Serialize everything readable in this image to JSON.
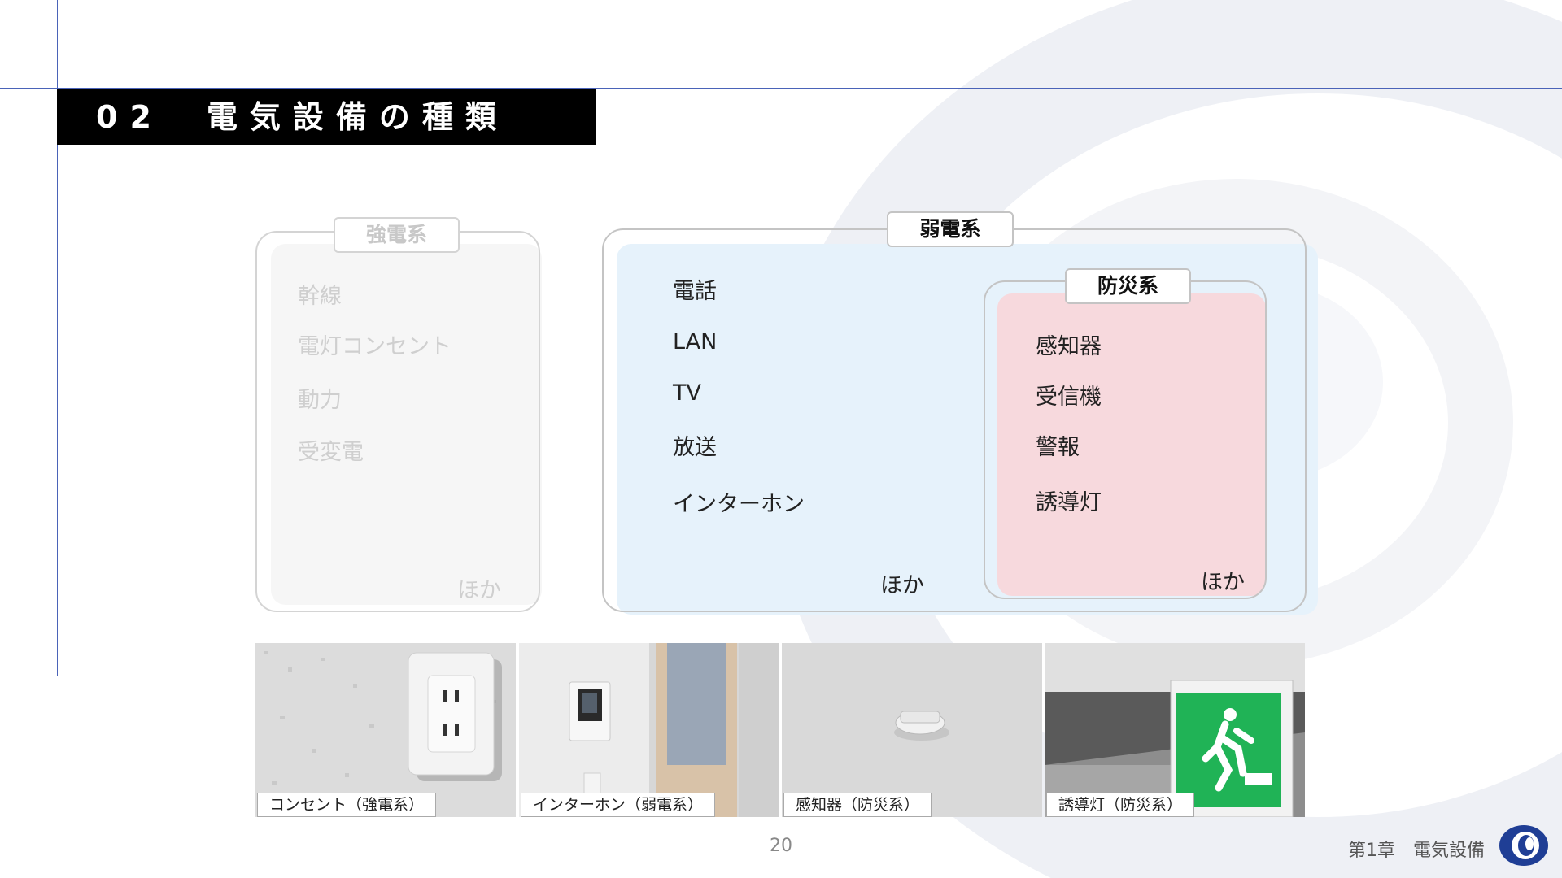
{
  "title": "02　電気設備の種類",
  "strong": {
    "tag": "強電系",
    "items": [
      "幹線",
      "電灯コンセント",
      "動力",
      "受変電"
    ],
    "other": "ほか"
  },
  "weak": {
    "tag": "弱電系",
    "items": [
      "電話",
      "LAN",
      "TV",
      "放送",
      "インターホン"
    ],
    "other": "ほか"
  },
  "disaster": {
    "tag": "防災系",
    "items": [
      "感知器",
      "受信機",
      "警報",
      "誘導灯"
    ],
    "other": "ほか"
  },
  "photos": [
    {
      "caption": "コンセント（強電系）"
    },
    {
      "caption": "インターホン（弱電系）"
    },
    {
      "caption": "感知器（防災系）"
    },
    {
      "caption": "誘導灯（防災系）"
    }
  ],
  "footer": {
    "page": "20",
    "chapter": "第1章　電気設備"
  },
  "colors": {
    "accent_line": "#4a63b8",
    "weak_fill": "#e6f2fb",
    "disaster_fill": "#f7d9dd",
    "title_bar": "#000000"
  }
}
